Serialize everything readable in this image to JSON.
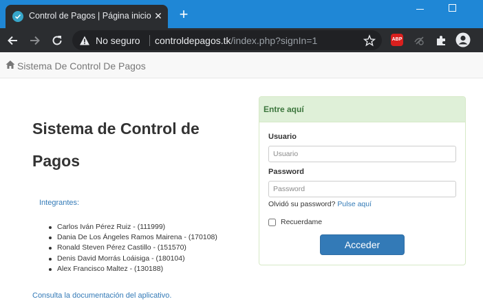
{
  "browser": {
    "tab_title": "Control de Pagos | Página inicio",
    "tab_close": "✕",
    "new_tab": "+",
    "security_label": "No seguro",
    "url_domain": "controldepagos.tk",
    "url_path": "/index.php?signIn=1",
    "abp_label": "ABP"
  },
  "navbar": {
    "brand": "Sistema De Control De Pagos"
  },
  "main": {
    "title": "Sistema de Control de Pagos",
    "members_label": "Integrantes:",
    "members": [
      "Carlos Iván Pérez Ruiz - (111999)",
      "Dania De Los Ángeles Ramos Mairena - (170108)",
      "Ronald Steven Pérez Castillo - (151570)",
      "Denis David Morrás Loáisiga - (180104)",
      "Alex Francisco Maltez - (130188)"
    ],
    "docs_link": "Consulta la documentación del aplicativo."
  },
  "login": {
    "heading": "Entre aquí",
    "user_label": "Usuario",
    "user_placeholder": "Usuario",
    "password_label": "Password",
    "password_placeholder": "Password",
    "forgot_text": "Olvidó su password?",
    "forgot_link": "Pulse aquí",
    "remember_label": "Recuerdame",
    "submit_label": "Acceder"
  },
  "colors": {
    "accent": "#337ab7",
    "panel_heading_bg": "#dff0d8",
    "panel_heading_text": "#3c763d",
    "tabbar": "#1f87d6"
  }
}
